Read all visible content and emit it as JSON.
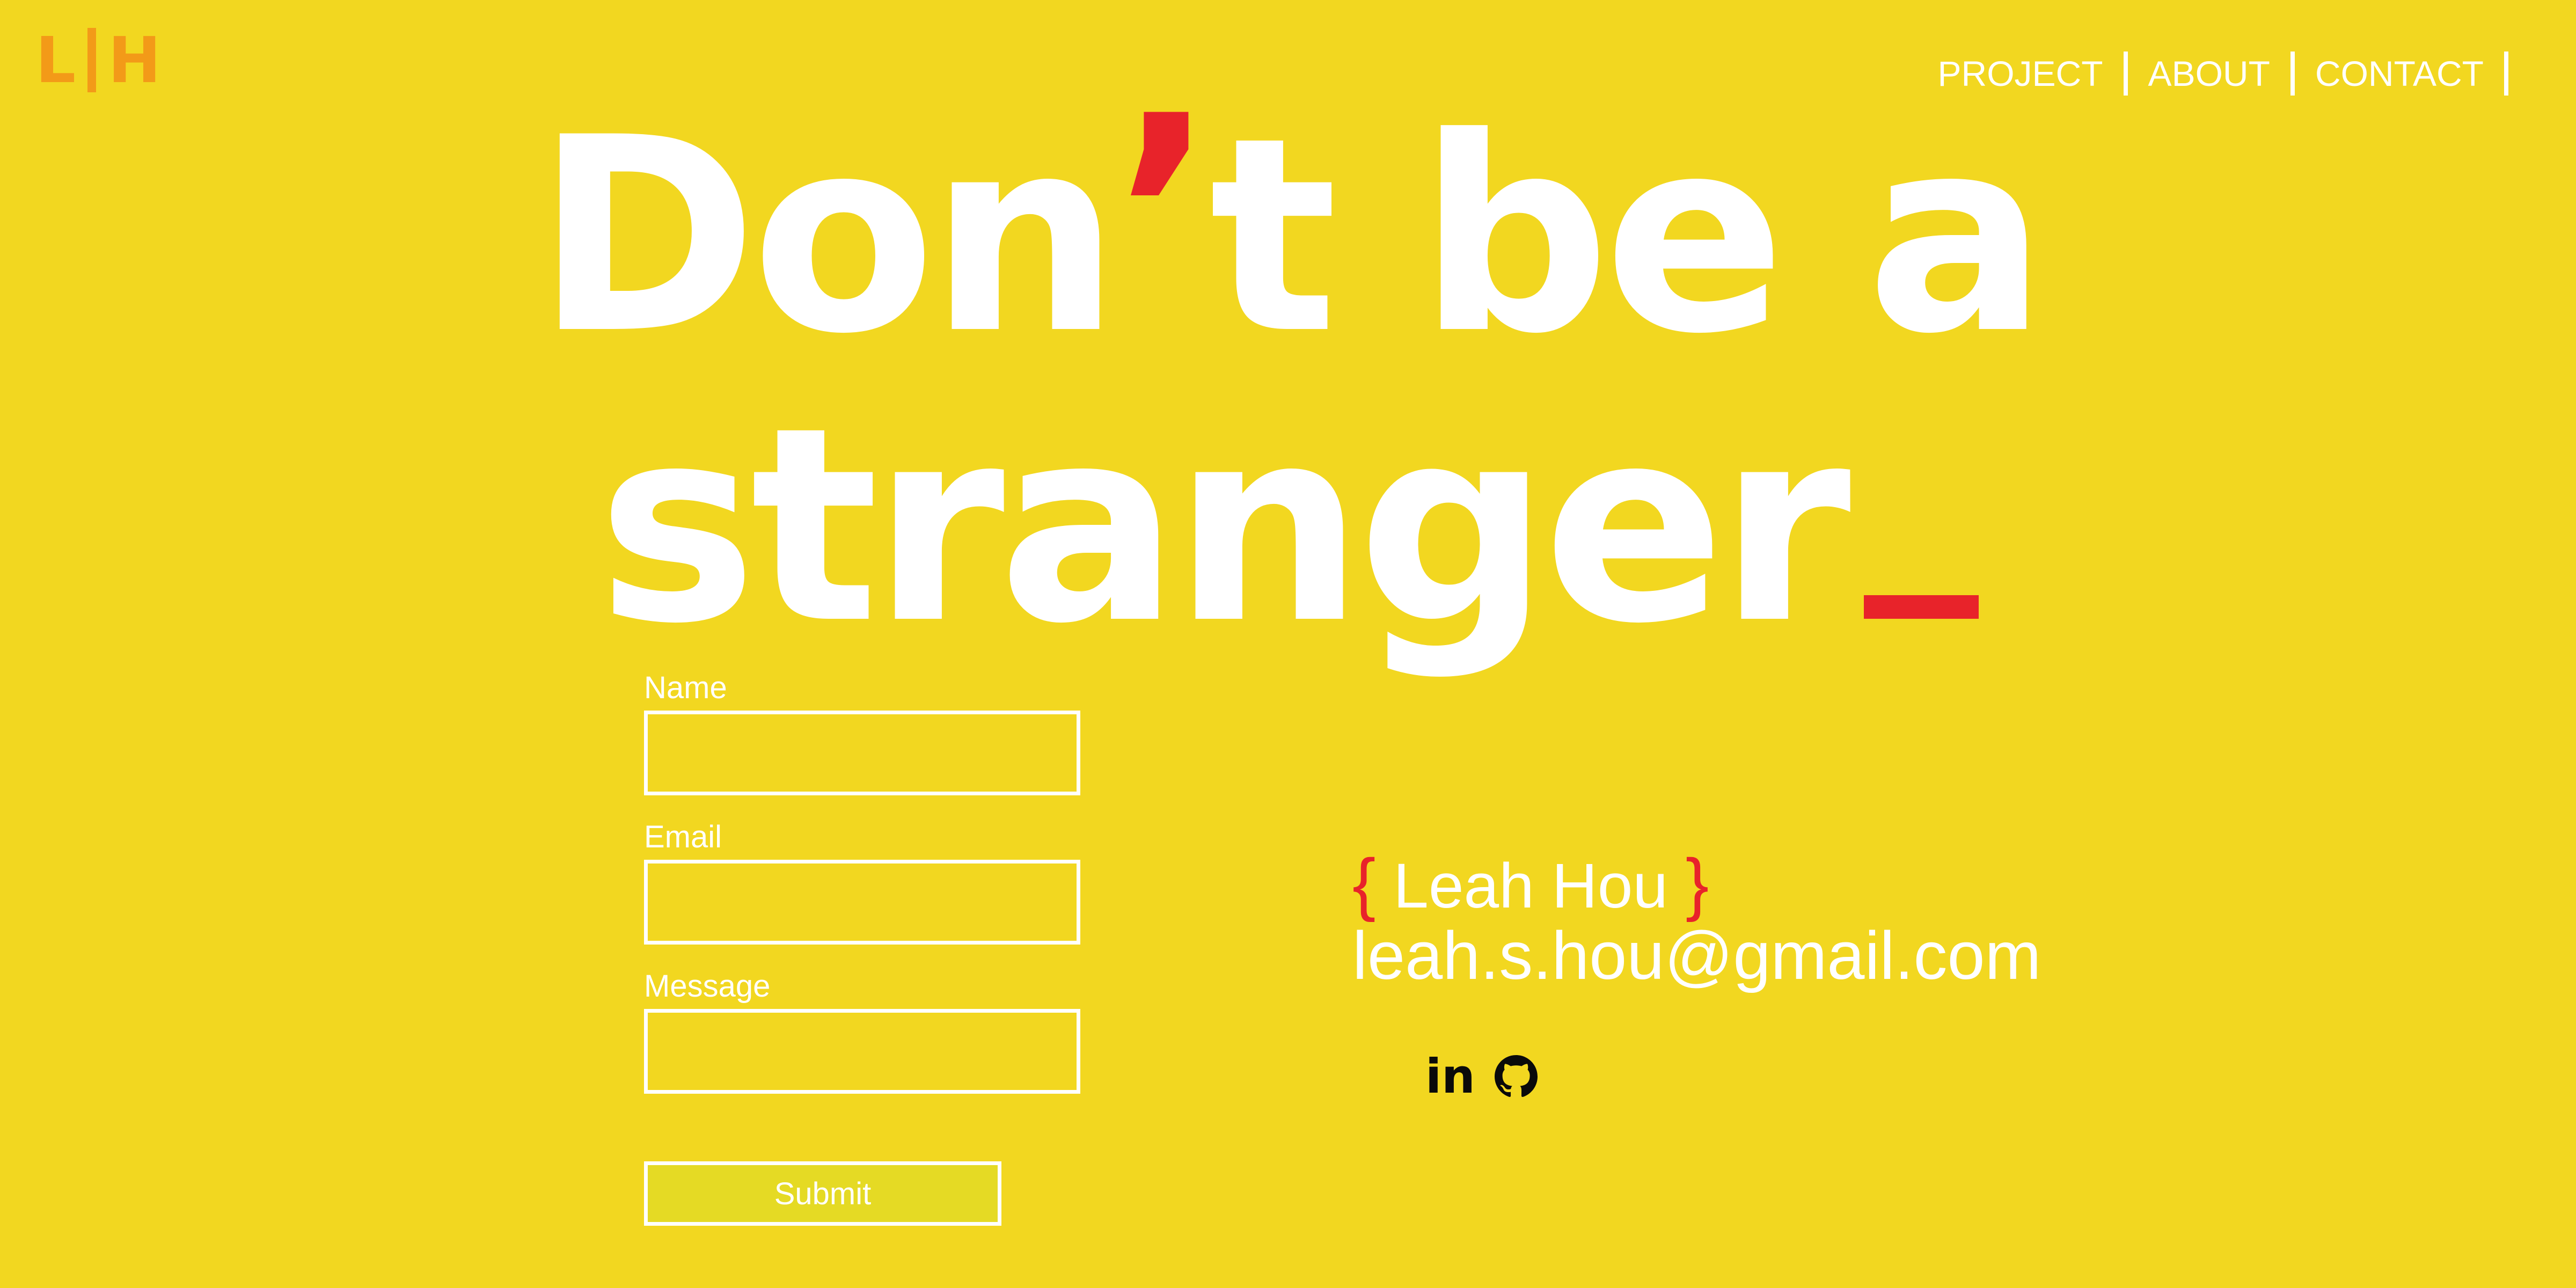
{
  "logo": {
    "left": "L",
    "right": "H"
  },
  "nav": {
    "items": [
      {
        "label": "PROJECT"
      },
      {
        "label": "ABOUT"
      },
      {
        "label": "CONTACT"
      }
    ]
  },
  "hero": {
    "line1_part1": "Don",
    "apostrophe": "’",
    "line1_part2": "t be a",
    "line2": "stranger"
  },
  "form": {
    "name_label": "Name",
    "email_label": "Email",
    "message_label": "Message",
    "name_value": "",
    "email_value": "",
    "message_value": "",
    "submit_label": "Submit"
  },
  "contact": {
    "brace_open": "{",
    "name": "Leah Hou",
    "brace_close": "}",
    "email": "leah.s.hou@gmail.com"
  },
  "social": {
    "linkedin_text": "in",
    "icons": [
      "linkedin-icon",
      "github-icon"
    ]
  },
  "colors": {
    "background": "#f2d720",
    "accent": "#e8232a",
    "logo": "#f39a18",
    "text": "#ffffff",
    "submit_bg": "#e5da24"
  }
}
